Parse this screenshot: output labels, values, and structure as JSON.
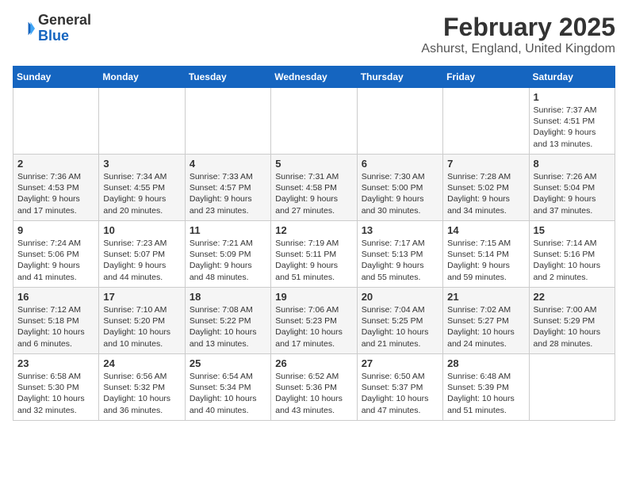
{
  "header": {
    "logo_general": "General",
    "logo_blue": "Blue",
    "month_title": "February 2025",
    "location": "Ashurst, England, United Kingdom"
  },
  "weekdays": [
    "Sunday",
    "Monday",
    "Tuesday",
    "Wednesday",
    "Thursday",
    "Friday",
    "Saturday"
  ],
  "weeks": [
    [
      {
        "day": "",
        "text": ""
      },
      {
        "day": "",
        "text": ""
      },
      {
        "day": "",
        "text": ""
      },
      {
        "day": "",
        "text": ""
      },
      {
        "day": "",
        "text": ""
      },
      {
        "day": "",
        "text": ""
      },
      {
        "day": "1",
        "text": "Sunrise: 7:37 AM\nSunset: 4:51 PM\nDaylight: 9 hours\nand 13 minutes."
      }
    ],
    [
      {
        "day": "2",
        "text": "Sunrise: 7:36 AM\nSunset: 4:53 PM\nDaylight: 9 hours\nand 17 minutes."
      },
      {
        "day": "3",
        "text": "Sunrise: 7:34 AM\nSunset: 4:55 PM\nDaylight: 9 hours\nand 20 minutes."
      },
      {
        "day": "4",
        "text": "Sunrise: 7:33 AM\nSunset: 4:57 PM\nDaylight: 9 hours\nand 23 minutes."
      },
      {
        "day": "5",
        "text": "Sunrise: 7:31 AM\nSunset: 4:58 PM\nDaylight: 9 hours\nand 27 minutes."
      },
      {
        "day": "6",
        "text": "Sunrise: 7:30 AM\nSunset: 5:00 PM\nDaylight: 9 hours\nand 30 minutes."
      },
      {
        "day": "7",
        "text": "Sunrise: 7:28 AM\nSunset: 5:02 PM\nDaylight: 9 hours\nand 34 minutes."
      },
      {
        "day": "8",
        "text": "Sunrise: 7:26 AM\nSunset: 5:04 PM\nDaylight: 9 hours\nand 37 minutes."
      }
    ],
    [
      {
        "day": "9",
        "text": "Sunrise: 7:24 AM\nSunset: 5:06 PM\nDaylight: 9 hours\nand 41 minutes."
      },
      {
        "day": "10",
        "text": "Sunrise: 7:23 AM\nSunset: 5:07 PM\nDaylight: 9 hours\nand 44 minutes."
      },
      {
        "day": "11",
        "text": "Sunrise: 7:21 AM\nSunset: 5:09 PM\nDaylight: 9 hours\nand 48 minutes."
      },
      {
        "day": "12",
        "text": "Sunrise: 7:19 AM\nSunset: 5:11 PM\nDaylight: 9 hours\nand 51 minutes."
      },
      {
        "day": "13",
        "text": "Sunrise: 7:17 AM\nSunset: 5:13 PM\nDaylight: 9 hours\nand 55 minutes."
      },
      {
        "day": "14",
        "text": "Sunrise: 7:15 AM\nSunset: 5:14 PM\nDaylight: 9 hours\nand 59 minutes."
      },
      {
        "day": "15",
        "text": "Sunrise: 7:14 AM\nSunset: 5:16 PM\nDaylight: 10 hours\nand 2 minutes."
      }
    ],
    [
      {
        "day": "16",
        "text": "Sunrise: 7:12 AM\nSunset: 5:18 PM\nDaylight: 10 hours\nand 6 minutes."
      },
      {
        "day": "17",
        "text": "Sunrise: 7:10 AM\nSunset: 5:20 PM\nDaylight: 10 hours\nand 10 minutes."
      },
      {
        "day": "18",
        "text": "Sunrise: 7:08 AM\nSunset: 5:22 PM\nDaylight: 10 hours\nand 13 minutes."
      },
      {
        "day": "19",
        "text": "Sunrise: 7:06 AM\nSunset: 5:23 PM\nDaylight: 10 hours\nand 17 minutes."
      },
      {
        "day": "20",
        "text": "Sunrise: 7:04 AM\nSunset: 5:25 PM\nDaylight: 10 hours\nand 21 minutes."
      },
      {
        "day": "21",
        "text": "Sunrise: 7:02 AM\nSunset: 5:27 PM\nDaylight: 10 hours\nand 24 minutes."
      },
      {
        "day": "22",
        "text": "Sunrise: 7:00 AM\nSunset: 5:29 PM\nDaylight: 10 hours\nand 28 minutes."
      }
    ],
    [
      {
        "day": "23",
        "text": "Sunrise: 6:58 AM\nSunset: 5:30 PM\nDaylight: 10 hours\nand 32 minutes."
      },
      {
        "day": "24",
        "text": "Sunrise: 6:56 AM\nSunset: 5:32 PM\nDaylight: 10 hours\nand 36 minutes."
      },
      {
        "day": "25",
        "text": "Sunrise: 6:54 AM\nSunset: 5:34 PM\nDaylight: 10 hours\nand 40 minutes."
      },
      {
        "day": "26",
        "text": "Sunrise: 6:52 AM\nSunset: 5:36 PM\nDaylight: 10 hours\nand 43 minutes."
      },
      {
        "day": "27",
        "text": "Sunrise: 6:50 AM\nSunset: 5:37 PM\nDaylight: 10 hours\nand 47 minutes."
      },
      {
        "day": "28",
        "text": "Sunrise: 6:48 AM\nSunset: 5:39 PM\nDaylight: 10 hours\nand 51 minutes."
      },
      {
        "day": "",
        "text": ""
      }
    ]
  ]
}
